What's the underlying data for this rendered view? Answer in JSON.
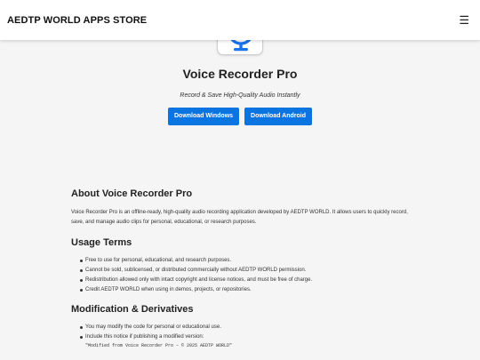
{
  "header": {
    "brand": "AEDTP WORLD APPS STORE",
    "menu_icon": "☰"
  },
  "app": {
    "icon": "microphone-icon",
    "title": "Voice Recorder Pro",
    "tagline": "Record & Save High-Quality Audio Instantly",
    "buttons": {
      "windows": "Download Windows",
      "android": "Download Android"
    }
  },
  "about": {
    "heading": "About Voice Recorder Pro",
    "text": "Voice Recorder Pro is an offline-ready, high-quality audio recording application developed by AEDTP WORLD. It allows users to quickly record, save, and manage audio clips for personal, educational, or research purposes."
  },
  "usage": {
    "heading": "Usage Terms",
    "items": [
      "Free to use for personal, educational, and research purposes.",
      "Cannot be sold, sublicensed, or distributed commercially without AEDTP WORLD permission.",
      "Redistribution allowed only with intact copyright and license notices, and must be free of charge.",
      "Credit AEDTP WORLD when using in demos, projects, or repositories."
    ]
  },
  "modification": {
    "heading": "Modification & Derivatives",
    "items": [
      "You may modify the code for personal or educational use.",
      "Include this notice if publishing a modified version:"
    ],
    "notice": "\"Modified from Voice Recorder Pro – © 2025 AEDTP WORLD\""
  },
  "colors": {
    "accent": "#0a74e0",
    "icon_blue": "#1a73e8",
    "sparkle": "#f4c20d"
  }
}
